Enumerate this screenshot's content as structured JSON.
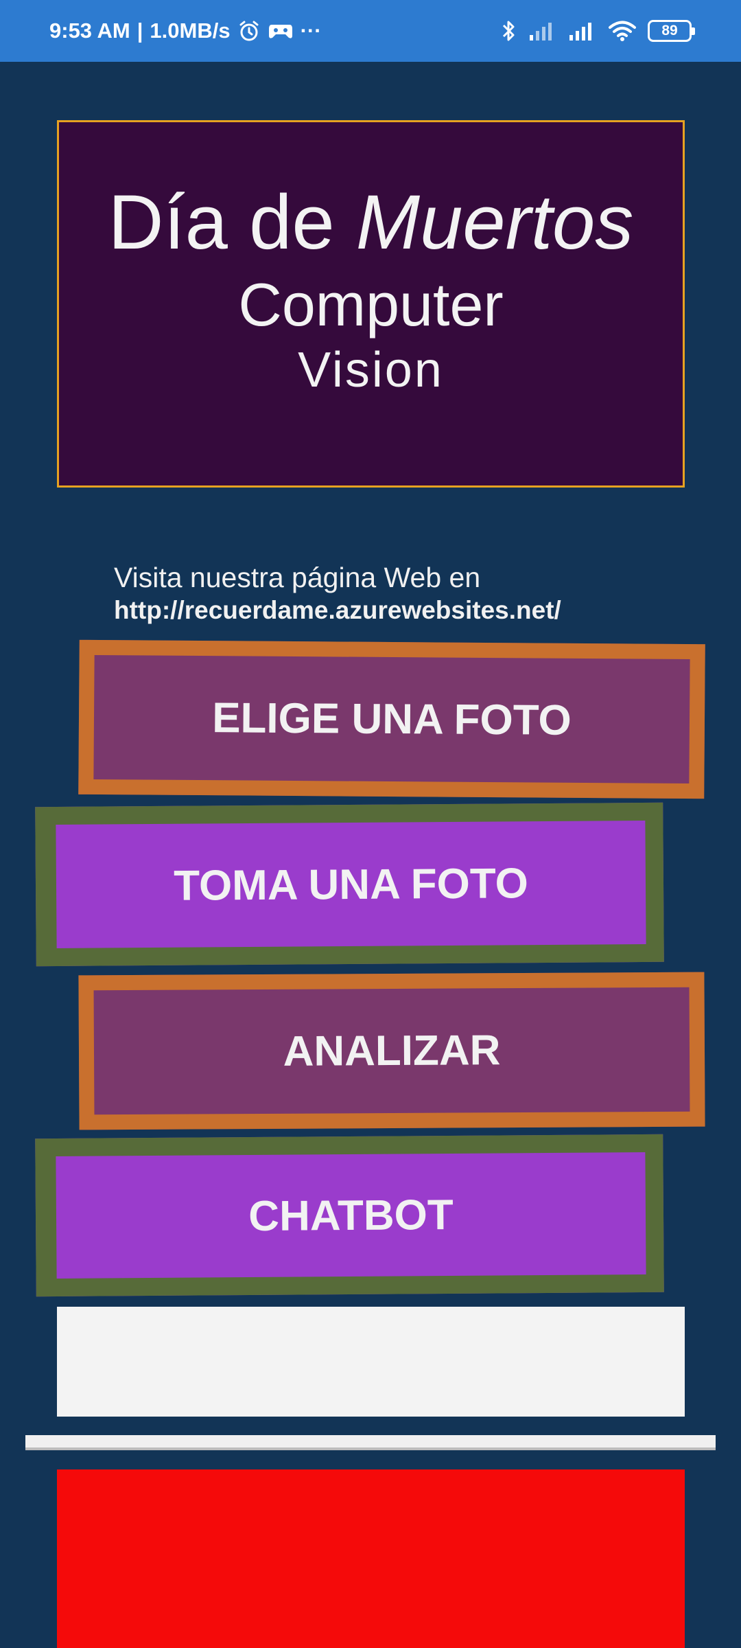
{
  "status_bar": {
    "time": "9:53 AM",
    "separator": "|",
    "speed": "1.0MB/s",
    "more": "···",
    "battery": "89",
    "icons": [
      "alarm-icon",
      "gamepad-icon",
      "bluetooth-icon",
      "signal-icon",
      "signal-icon",
      "wifi-icon",
      "battery-icon"
    ]
  },
  "title": {
    "word1": "Día de",
    "word2": "Muertos",
    "line2": "Computer",
    "line3": "Vision"
  },
  "visit": {
    "text": "Visita nuestra página Web en",
    "url": "http://recuerdame.azurewebsites.net/"
  },
  "buttons": {
    "elige": "ELIGE UNA FOTO",
    "toma": "TOMA UNA FOTO",
    "analizar": "ANALIZAR",
    "chatbot": "CHATBOT"
  },
  "colors": {
    "background": "#123456",
    "status_bar": "#2d7bd0",
    "title_bg": "#350a3c",
    "title_border": "#e6a221",
    "orange_border": "#c9702e",
    "orange_fill": "#7a386c",
    "green_border": "#576b39",
    "purple_fill": "#9a3ccc",
    "red_panel": "#f50a0a"
  }
}
